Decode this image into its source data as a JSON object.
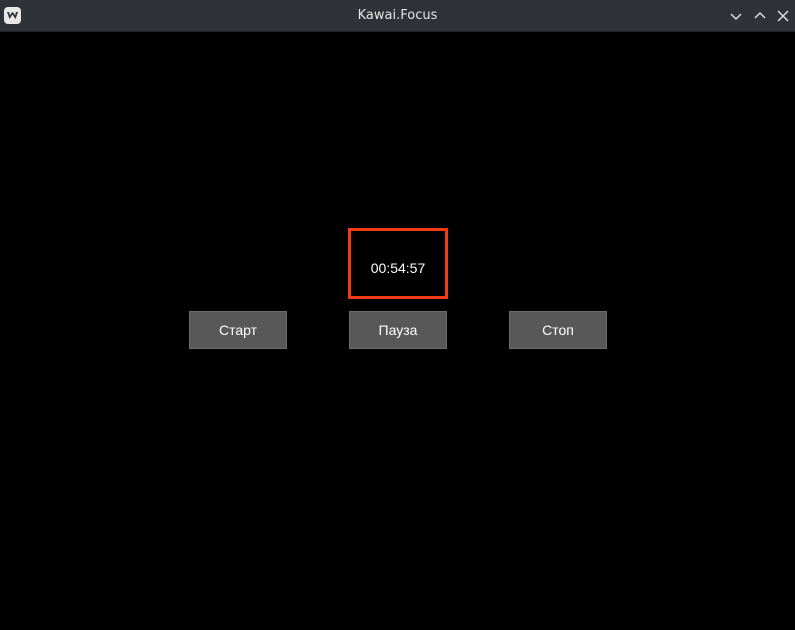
{
  "window": {
    "title": "Kawai.Focus"
  },
  "timer": {
    "value": "00:54:57",
    "highlight_color": "#f23a14"
  },
  "buttons": {
    "start_label": "Старт",
    "pause_label": "Пауза",
    "stop_label": "Стоп"
  },
  "icons": {
    "app": "app-logo-icon",
    "minimize": "chevron-down-icon",
    "maximize": "chevron-up-icon",
    "close": "close-icon"
  },
  "colors": {
    "background": "#000000",
    "titlebar": "#2f3338",
    "button": "#585858",
    "text": "#ffffff"
  }
}
